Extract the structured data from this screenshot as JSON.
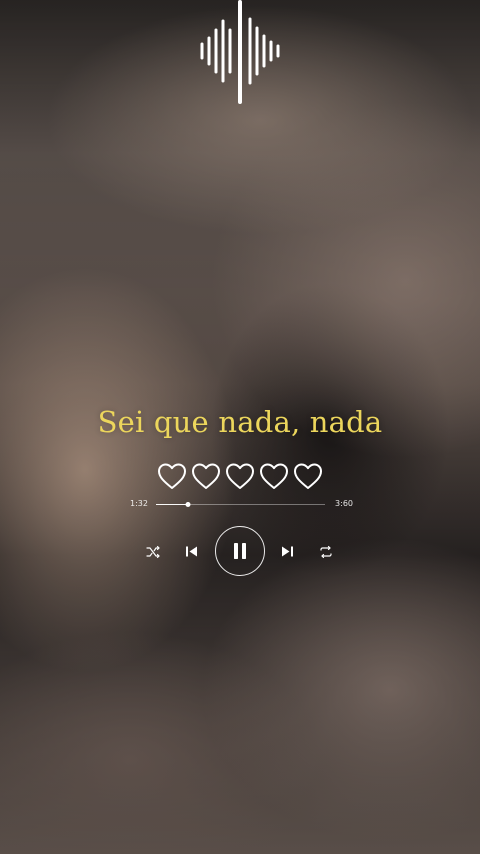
{
  "player": {
    "lyric": "Sei que nada, nada",
    "current_time": "1:32",
    "total_time": "3:60",
    "progress_fraction": 0.19,
    "rating": 5,
    "rating_max": 5,
    "play_state": "playing",
    "controls": {
      "shuffle_icon": "shuffle-icon",
      "previous_icon": "previous-track-icon",
      "pause_icon": "pause-icon",
      "next_icon": "next-track-icon",
      "repeat_icon": "repeat-icon"
    },
    "colors": {
      "lyric": "#ecd65c",
      "controls": "#ffffff"
    }
  }
}
